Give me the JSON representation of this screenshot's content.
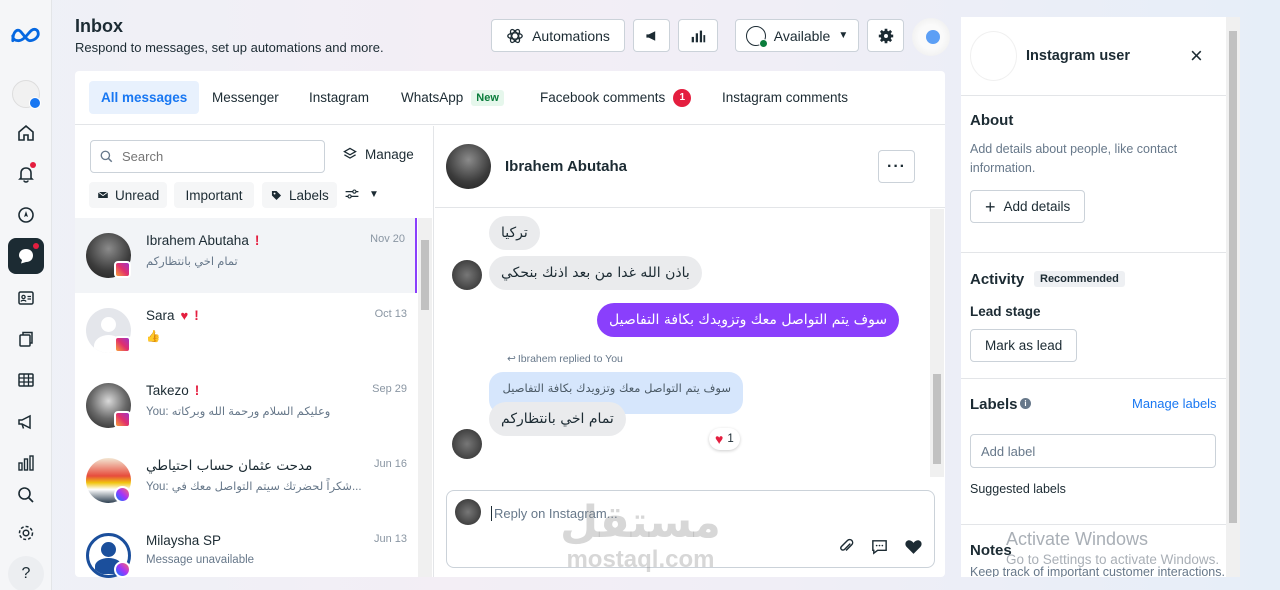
{
  "header": {
    "title": "Inbox",
    "subtitle": "Respond to messages, set up automations and more.",
    "automations_label": "Automations",
    "status_label": "Available"
  },
  "tabs": [
    {
      "label": "All messages",
      "active": true
    },
    {
      "label": "Messenger"
    },
    {
      "label": "Instagram"
    },
    {
      "label": "WhatsApp",
      "badge": "New"
    },
    {
      "label": "Facebook comments",
      "count": "1"
    },
    {
      "label": "Instagram comments"
    }
  ],
  "list": {
    "search_placeholder": "Search",
    "manage_label": "Manage",
    "filters": {
      "unread": "Unread",
      "important": "Important",
      "labels": "Labels"
    },
    "conversations": [
      {
        "name": "Ibrahem Abutaha",
        "preview": "تمام اخي بانتظاركم",
        "date": "Nov 20",
        "platform": "instagram",
        "important": true
      },
      {
        "name": "Sara",
        "preview": "👍",
        "date": "Oct 13",
        "platform": "instagram",
        "important": true,
        "heart": true
      },
      {
        "name": "Takezo",
        "preview": "You: وعليكم السلام ورحمة الله وبركاته",
        "date": "Sep 29",
        "platform": "instagram",
        "important": true
      },
      {
        "name": "مدحت عثمان حساب احتياطي",
        "preview": "You: شكراً لحضرتك سيتم التواصل معك في...",
        "date": "Jun 16",
        "platform": "messenger"
      },
      {
        "name": "Milaysha SP",
        "preview": "Message unavailable",
        "date": "Jun 13",
        "platform": "messenger"
      }
    ]
  },
  "chat": {
    "contact_name": "Ibrahem Abutaha",
    "more_label": "···",
    "messages": {
      "m1": "تركيا",
      "m2": "باذن الله غدا من بعد اذنك بنحكي",
      "m3": "سوف يتم التواصل معك وتزويدك بكافة التفاصيل",
      "reply_note": "Ibrahem replied to You",
      "quoted": "سوف يتم التواصل معك وتزويدك بكافة التفاصيل",
      "m4": "تمام اخي بانتظاركم",
      "reaction_count": "1"
    },
    "reply_placeholder": "Reply on Instagram..."
  },
  "profile": {
    "name": "Instagram user",
    "about_title": "About",
    "about_text": "Add details about people, like contact information.",
    "add_details_label": "Add details",
    "activity_title": "Activity",
    "recommended_badge": "Recommended",
    "lead_stage_title": "Lead stage",
    "mark_lead_label": "Mark as lead",
    "labels_title": "Labels",
    "manage_labels_label": "Manage labels",
    "add_label_placeholder": "Add label",
    "suggested_labels": "Suggested labels",
    "notes_title": "Notes",
    "notes_text": "Keep track of important customer interactions."
  },
  "watermarks": {
    "windows_line1": "Activate Windows",
    "windows_line2": "Go to Settings to activate Windows.",
    "mostaql_ar": "مستقل",
    "mostaql_en": "mostaql.com"
  },
  "colors": {
    "accent": "#1877f2",
    "outgoing": "#8a3ffc",
    "alert": "#e41e3f"
  }
}
